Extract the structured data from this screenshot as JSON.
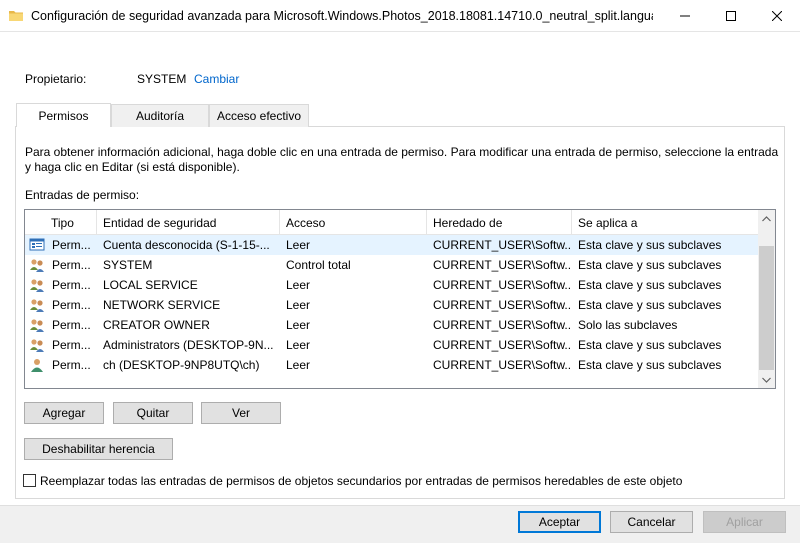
{
  "window": {
    "title": "Configuración de seguridad avanzada para Microsoft.Windows.Photos_2018.18081.14710.0_neutral_split.langua...",
    "icons": {
      "app": "folder-icon",
      "minimize": "minimize-icon",
      "maximize": "maximize-icon",
      "close": "close-icon"
    }
  },
  "owner": {
    "label": "Propietario:",
    "value": "SYSTEM",
    "change_link": "Cambiar"
  },
  "tabs": [
    {
      "label": "Permisos",
      "active": true
    },
    {
      "label": "Auditoría",
      "active": false
    },
    {
      "label": "Acceso efectivo",
      "active": false
    }
  ],
  "info_text": "Para obtener información adicional, haga doble clic en una entrada de permiso. Para modificar una entrada de permiso, seleccione la entrada y haga clic en Editar (si está disponible).",
  "entries_label": "Entradas de permiso:",
  "table": {
    "headers": [
      "Tipo",
      "Entidad de seguridad",
      "Acceso",
      "Heredado de",
      "Se aplica a"
    ],
    "rows": [
      {
        "icon": "unknown-account-icon",
        "type": "Perm...",
        "principal": "Cuenta desconocida (S-1-15-...",
        "access": "Leer",
        "inherited": "CURRENT_USER\\Softw...",
        "applies": "Esta clave y sus subclaves",
        "selected": true
      },
      {
        "icon": "group-users-icon",
        "type": "Perm...",
        "principal": "SYSTEM",
        "access": "Control total",
        "inherited": "CURRENT_USER\\Softw...",
        "applies": "Esta clave y sus subclaves",
        "selected": false
      },
      {
        "icon": "group-users-icon",
        "type": "Perm...",
        "principal": "LOCAL SERVICE",
        "access": "Leer",
        "inherited": "CURRENT_USER\\Softw...",
        "applies": "Esta clave y sus subclaves",
        "selected": false
      },
      {
        "icon": "group-users-icon",
        "type": "Perm...",
        "principal": "NETWORK SERVICE",
        "access": "Leer",
        "inherited": "CURRENT_USER\\Softw...",
        "applies": "Esta clave y sus subclaves",
        "selected": false
      },
      {
        "icon": "group-users-icon",
        "type": "Perm...",
        "principal": "CREATOR OWNER",
        "access": "Leer",
        "inherited": "CURRENT_USER\\Softw...",
        "applies": "Solo las subclaves",
        "selected": false
      },
      {
        "icon": "group-users-icon",
        "type": "Perm...",
        "principal": "Administrators (DESKTOP-9N...",
        "access": "Leer",
        "inherited": "CURRENT_USER\\Softw...",
        "applies": "Esta clave y sus subclaves",
        "selected": false
      },
      {
        "icon": "user-icon",
        "type": "Perm...",
        "principal": "ch (DESKTOP-9NP8UTQ\\ch)",
        "access": "Leer",
        "inherited": "CURRENT_USER\\Softw...",
        "applies": "Esta clave y sus subclaves",
        "selected": false
      }
    ]
  },
  "buttons": {
    "add": "Agregar",
    "remove": "Quitar",
    "view": "Ver",
    "disable_inheritance": "Deshabilitar herencia",
    "accept": "Aceptar",
    "cancel": "Cancelar",
    "apply": "Aplicar"
  },
  "replace_checkbox": {
    "label": "Reemplazar todas las entradas de permisos de objetos secundarios por entradas de permisos heredables de este objeto",
    "checked": false
  },
  "colors": {
    "link": "#0066cc",
    "selected_row": "#e5f3ff",
    "default_button_border": "#0078d7"
  }
}
